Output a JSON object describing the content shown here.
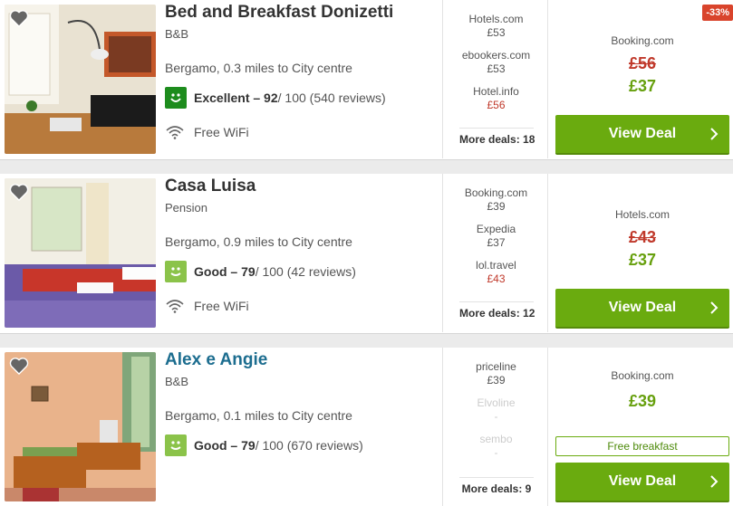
{
  "colors": {
    "accent": "#6aab0f",
    "discount": "#d9442c",
    "old_price": "#c0392b",
    "new_price": "#67a00e",
    "excellent": "#1d8c1d",
    "good": "#8bc34a"
  },
  "hotels": [
    {
      "name": "Bed and Breakfast Donizetti",
      "type": "B&B",
      "location": "Bergamo, 0.3 miles to City centre",
      "rating_word": "Excellent – 92",
      "rating_rest": " / 100 (540 reviews)",
      "amenity": "Free WiFi",
      "deals": [
        {
          "provider": "Hotels.com",
          "price": "£53"
        },
        {
          "provider": "ebookers.com",
          "price": "£53"
        },
        {
          "provider": "Hotel.info",
          "price": "£56"
        }
      ],
      "more_deals": "More deals: 18",
      "best_provider": "Booking.com",
      "old_price": "£56",
      "price": "£37",
      "discount": "-33%",
      "button": "View Deal"
    },
    {
      "name": "Casa Luisa",
      "type": "Pension",
      "location": "Bergamo, 0.9 miles to City centre",
      "rating_word": "Good – 79",
      "rating_rest": " / 100 (42 reviews)",
      "amenity": "Free WiFi",
      "deals": [
        {
          "provider": "Booking.com",
          "price": "£39"
        },
        {
          "provider": "Expedia",
          "price": "£37"
        },
        {
          "provider": "lol.travel",
          "price": "£43"
        }
      ],
      "more_deals": "More deals: 12",
      "best_provider": "Hotels.com",
      "old_price": "£43",
      "price": "£37",
      "button": "View Deal"
    },
    {
      "name": "Alex e Angie",
      "type": "B&B",
      "location": "Bergamo, 0.1 miles to City centre",
      "rating_word": "Good – 79",
      "rating_rest": " / 100 (670 reviews)",
      "deals": [
        {
          "provider": "priceline",
          "price": "£39"
        },
        {
          "provider": "Elvoline",
          "price": "-"
        },
        {
          "provider": "sembo",
          "price": "-"
        }
      ],
      "more_deals": "More deals: 9",
      "best_provider": "Booking.com",
      "price": "£39",
      "extra": "Free breakfast",
      "button": "View Deal"
    }
  ]
}
